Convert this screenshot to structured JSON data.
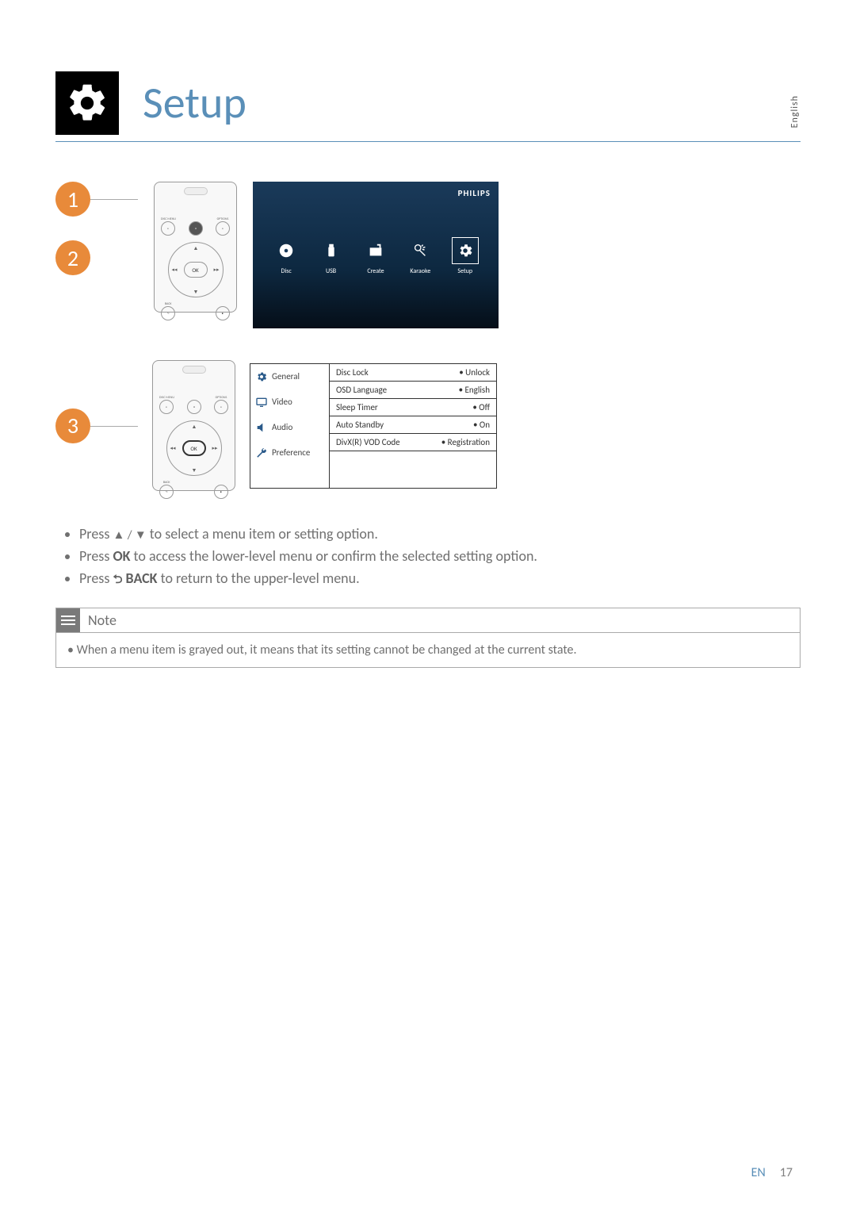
{
  "page": {
    "title": "Setup",
    "language_tab": "English",
    "footer_lang": "EN",
    "footer_page": "17"
  },
  "steps": {
    "s1": "1",
    "s2": "2",
    "s3": "3"
  },
  "remote": {
    "disc_menu": "DISC MENU",
    "options": "OPTIONS",
    "ok": "OK",
    "back": "BACK"
  },
  "tv": {
    "brand": "PHILIPS",
    "items": {
      "disc": "Disc",
      "usb": "USB",
      "create": "Create",
      "karaoke": "Karaoke",
      "setup": "Setup"
    }
  },
  "setup_menu": {
    "tabs": {
      "general": "General",
      "video": "Video",
      "audio": "Audio",
      "preference": "Preference"
    },
    "rows": {
      "disc_lock": {
        "label": "Disc Lock",
        "value": "• Unlock"
      },
      "osd_language": {
        "label": "OSD Language",
        "value": "• English"
      },
      "sleep_timer": {
        "label": "Sleep Timer",
        "value": "• Off"
      },
      "auto_standby": {
        "label": "Auto Standby",
        "value": "• On"
      },
      "divx": {
        "label": "DivX(R) VOD Code",
        "value": "• Registration"
      }
    }
  },
  "instructions": {
    "l1_pre": "Press ",
    "l1_arrows": "▲ / ▼",
    "l1_post": " to select a menu item or setting option.",
    "l2_pre": "Press ",
    "l2_bold": "OK",
    "l2_post": " to access the lower-level menu or confirm the selected setting option.",
    "l3_pre": "Press ",
    "l3_glyph": "⮌",
    "l3_bold": " BACK",
    "l3_post": " to return to the upper-level menu."
  },
  "note": {
    "heading": "Note",
    "body": "• When a menu item is grayed out, it means that its setting cannot be changed at the current state."
  }
}
